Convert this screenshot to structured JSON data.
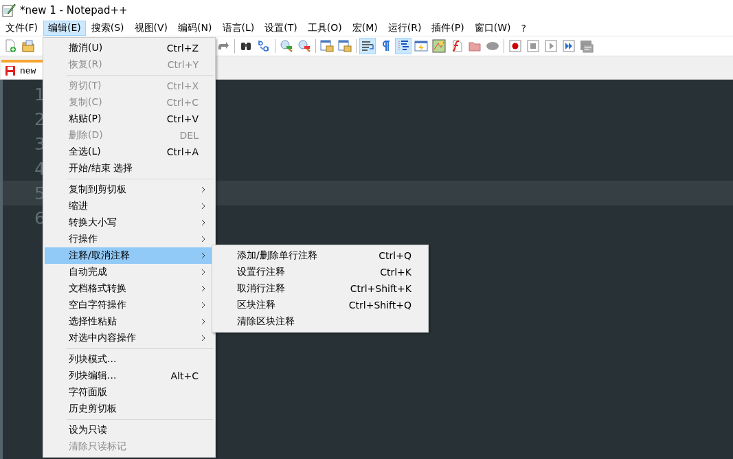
{
  "window": {
    "title": "*new 1 - Notepad++"
  },
  "menubar": [
    {
      "label": "文件(F)",
      "selected": false
    },
    {
      "label": "编辑(E)",
      "selected": true
    },
    {
      "label": "搜索(S)",
      "selected": false
    },
    {
      "label": "视图(V)",
      "selected": false
    },
    {
      "label": "编码(N)",
      "selected": false
    },
    {
      "label": "语言(L)",
      "selected": false
    },
    {
      "label": "设置(T)",
      "selected": false
    },
    {
      "label": "工具(O)",
      "selected": false
    },
    {
      "label": "宏(M)",
      "selected": false
    },
    {
      "label": "运行(R)",
      "selected": false
    },
    {
      "label": "插件(P)",
      "selected": false
    },
    {
      "label": "窗口(W)",
      "selected": false
    },
    {
      "label": "?",
      "selected": false
    }
  ],
  "toolbar": {
    "groups": [
      {
        "buttons": [
          {
            "kind": "new",
            "pressed": false
          },
          {
            "kind": "open",
            "pressed": false
          }
        ]
      },
      {
        "buttons": [
          {
            "kind": "redo",
            "pressed": false
          }
        ]
      },
      {
        "buttons": [
          {
            "kind": "find",
            "pressed": false
          },
          {
            "kind": "replace",
            "pressed": false
          }
        ]
      },
      {
        "buttons": [
          {
            "kind": "zoom-in",
            "pressed": false
          },
          {
            "kind": "zoom-out",
            "pressed": false
          }
        ]
      },
      {
        "buttons": [
          {
            "kind": "sync-v",
            "pressed": false
          },
          {
            "kind": "sync-h",
            "pressed": false
          }
        ]
      },
      {
        "buttons": [
          {
            "kind": "wrap",
            "pressed": true
          },
          {
            "kind": "all-chars",
            "pressed": false
          },
          {
            "kind": "indent-guide",
            "pressed": true
          },
          {
            "kind": "udl",
            "pressed": false
          },
          {
            "kind": "doc-map",
            "pressed": false
          },
          {
            "kind": "function-list",
            "pressed": false
          },
          {
            "kind": "folder",
            "pressed": false
          },
          {
            "kind": "monitor",
            "pressed": false
          }
        ]
      },
      {
        "buttons": [
          {
            "kind": "record",
            "pressed": false
          },
          {
            "kind": "stop",
            "pressed": false
          },
          {
            "kind": "play",
            "pressed": false
          },
          {
            "kind": "play-multi",
            "pressed": false
          },
          {
            "kind": "save-macro",
            "pressed": false
          }
        ]
      }
    ]
  },
  "tabs": [
    {
      "label": "new",
      "selected": true,
      "modified": true
    }
  ],
  "editor": {
    "lines": [
      {
        "number": "1",
        "current": false
      },
      {
        "number": "2",
        "current": false
      },
      {
        "number": "3",
        "current": false
      },
      {
        "number": "4",
        "current": false
      },
      {
        "number": "5",
        "current": true
      },
      {
        "number": "6",
        "current": false
      }
    ]
  },
  "edit_menu": {
    "groups": [
      {
        "items": [
          {
            "label": "撤消(U)",
            "shortcut": "Ctrl+Z",
            "disabled": false,
            "has_submenu": false,
            "selected": false
          },
          {
            "label": "恢复(R)",
            "shortcut": "Ctrl+Y",
            "disabled": true,
            "has_submenu": false,
            "selected": false
          }
        ]
      },
      {
        "items": [
          {
            "label": "剪切(T)",
            "shortcut": "Ctrl+X",
            "disabled": true,
            "has_submenu": false,
            "selected": false
          },
          {
            "label": "复制(C)",
            "shortcut": "Ctrl+C",
            "disabled": true,
            "has_submenu": false,
            "selected": false
          },
          {
            "label": "粘贴(P)",
            "shortcut": "Ctrl+V",
            "disabled": false,
            "has_submenu": false,
            "selected": false
          },
          {
            "label": "删除(D)",
            "shortcut": "DEL",
            "disabled": true,
            "has_submenu": false,
            "selected": false
          },
          {
            "label": "全选(L)",
            "shortcut": "Ctrl+A",
            "disabled": false,
            "has_submenu": false,
            "selected": false
          },
          {
            "label": "开始/结束 选择",
            "disabled": false,
            "has_submenu": false,
            "selected": false
          }
        ]
      },
      {
        "items": [
          {
            "label": "复制到剪切板",
            "disabled": false,
            "has_submenu": true,
            "selected": false
          },
          {
            "label": "缩进",
            "disabled": false,
            "has_submenu": true,
            "selected": false
          },
          {
            "label": "转换大小写",
            "disabled": false,
            "has_submenu": true,
            "selected": false
          },
          {
            "label": "行操作",
            "disabled": false,
            "has_submenu": true,
            "selected": false
          },
          {
            "label": "注释/取消注释",
            "disabled": false,
            "has_submenu": true,
            "selected": true
          },
          {
            "label": "自动完成",
            "disabled": false,
            "has_submenu": true,
            "selected": false
          },
          {
            "label": "文档格式转换",
            "disabled": false,
            "has_submenu": true,
            "selected": false
          },
          {
            "label": "空白字符操作",
            "disabled": false,
            "has_submenu": true,
            "selected": false
          },
          {
            "label": "选择性粘贴",
            "disabled": false,
            "has_submenu": true,
            "selected": false
          },
          {
            "label": "对选中内容操作",
            "disabled": false,
            "has_submenu": true,
            "selected": false
          }
        ]
      },
      {
        "items": [
          {
            "label": "列块模式...",
            "disabled": false,
            "has_submenu": false,
            "selected": false
          },
          {
            "label": "列块编辑...",
            "shortcut": "Alt+C",
            "disabled": false,
            "has_submenu": false,
            "selected": false
          },
          {
            "label": "字符面版",
            "disabled": false,
            "has_submenu": false,
            "selected": false
          },
          {
            "label": "历史剪切板",
            "disabled": false,
            "has_submenu": false,
            "selected": false
          }
        ]
      },
      {
        "items": [
          {
            "label": "设为只读",
            "disabled": false,
            "has_submenu": false,
            "selected": false
          },
          {
            "label": "清除只读标记",
            "disabled": true,
            "has_submenu": false,
            "selected": false
          }
        ]
      }
    ]
  },
  "comment_submenu": {
    "items": [
      {
        "label": "添加/删除单行注释",
        "shortcut": "Ctrl+Q",
        "selected": false
      },
      {
        "label": "设置行注释",
        "shortcut": "Ctrl+K",
        "selected": false
      },
      {
        "label": "取消行注释",
        "shortcut": "Ctrl+Shift+K",
        "selected": false
      },
      {
        "label": "区块注释",
        "shortcut": "Ctrl+Shift+Q",
        "selected": false
      },
      {
        "label": "清除区块注释",
        "selected": false
      }
    ]
  }
}
